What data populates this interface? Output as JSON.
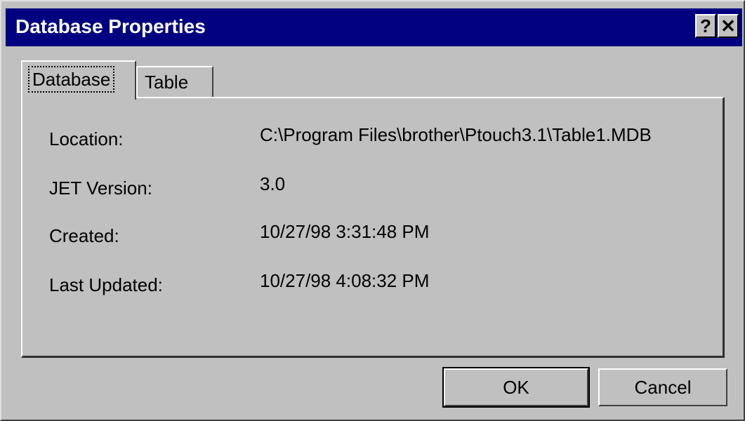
{
  "window": {
    "title": "Database Properties",
    "help_button": "?",
    "close_button": "✕"
  },
  "tabs": [
    {
      "label": "Database",
      "active": true
    },
    {
      "label": "Table",
      "active": false
    }
  ],
  "properties": [
    {
      "label": "Location:",
      "value": "C:\\Program Files\\brother\\Ptouch3.1\\Table1.MDB"
    },
    {
      "label": "JET Version:",
      "value": "3.0"
    },
    {
      "label": "Created:",
      "value": "10/27/98 3:31:48 PM"
    },
    {
      "label": "Last Updated:",
      "value": "10/27/98 4:08:32 PM"
    }
  ],
  "buttons": {
    "ok": "OK",
    "cancel": "Cancel"
  },
  "colors": {
    "title_bar": "#000080",
    "face": "#c0c0c0"
  }
}
